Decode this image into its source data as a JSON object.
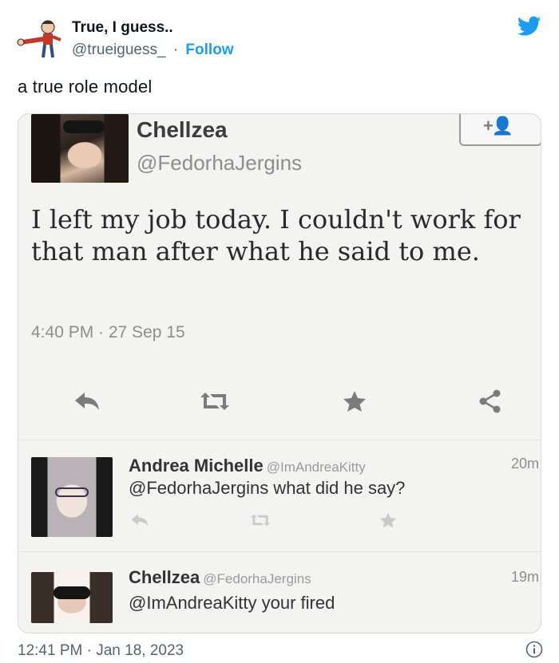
{
  "outer": {
    "author_name": "True, I guess..",
    "author_handle": "@trueiguess_",
    "dot": "·",
    "follow_label": "Follow",
    "tweet_text": "a true role model",
    "timestamp": "12:41 PM · Jan 18, 2023",
    "brand_color": "#1d9bf0"
  },
  "screenshot": {
    "main_tweet": {
      "name": "Chellzea",
      "handle": "@FedorhaJergins",
      "text": "I left my job today. I couldn't work for that man after what he said to me.",
      "time": "4:40 PM · 27 Sep 15",
      "follow_icon": "add-user-icon",
      "follow_icon_glyph": "+👤",
      "actions": [
        "reply-icon",
        "retweet-icon",
        "favorite-icon",
        "share-icon"
      ]
    },
    "replies": [
      {
        "name": "Andrea Michelle",
        "handle": "@ImAndreaKitty",
        "time": "20m",
        "text": "@FedorhaJergins what did he say?"
      },
      {
        "name": "Chellzea",
        "handle": "@FedorhaJergins",
        "time": "19m",
        "text": "@ImAndreaKitty your fired"
      }
    ]
  },
  "icons": {
    "bird": "twitter-bird-icon",
    "info": "info-icon",
    "avatar": "avatar"
  }
}
